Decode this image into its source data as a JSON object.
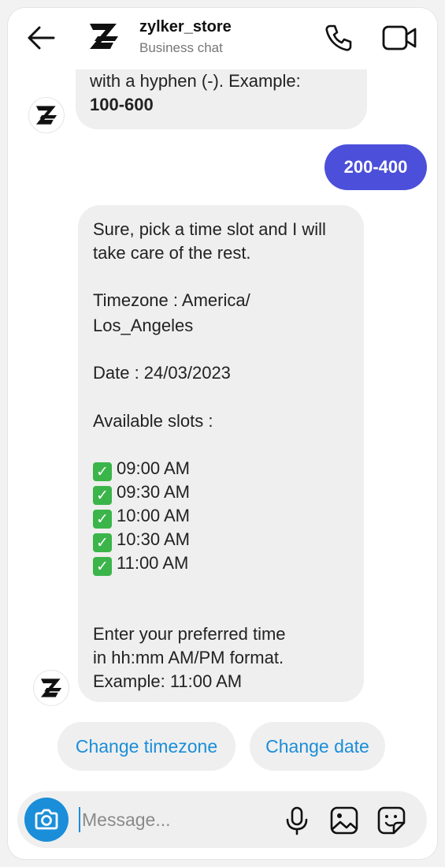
{
  "header": {
    "title": "zylker_store",
    "subtitle": "Business chat",
    "icons": [
      "back-arrow-icon",
      "brand-logo-icon",
      "phone-icon",
      "video-camera-icon"
    ]
  },
  "messages": {
    "incoming_1": {
      "text": "with a hyphen (-). Example:",
      "bold": "100-600"
    },
    "outgoing_1": {
      "text": "200-400"
    },
    "incoming_2": {
      "line1": "Sure, pick a time slot and I will",
      "line2": "take care of the rest.",
      "line3": "Timezone : America/",
      "line4": "Los_Angeles",
      "line5": "Date : 24/03/2023",
      "line6": "Available slots :",
      "slots": [
        "09:00 AM",
        "09:30 AM",
        "10:00 AM",
        "10:30 AM",
        "11:00 AM"
      ],
      "line7": "Enter your preferred time",
      "line8": "in hh:mm AM/PM format.",
      "line9": "Example: 11:00 AM"
    }
  },
  "quick_replies": {
    "change_timezone": "Change timezone",
    "change_date": "Change date"
  },
  "composer": {
    "placeholder": "Message...",
    "icons": [
      "camera-icon",
      "microphone-icon",
      "gallery-icon",
      "sticker-icon"
    ]
  },
  "colors": {
    "accent": "#1a8ed8",
    "outgoing_bubble": "#4b4fd9",
    "incoming_bubble": "#efefef",
    "check": "#3bb54a"
  }
}
